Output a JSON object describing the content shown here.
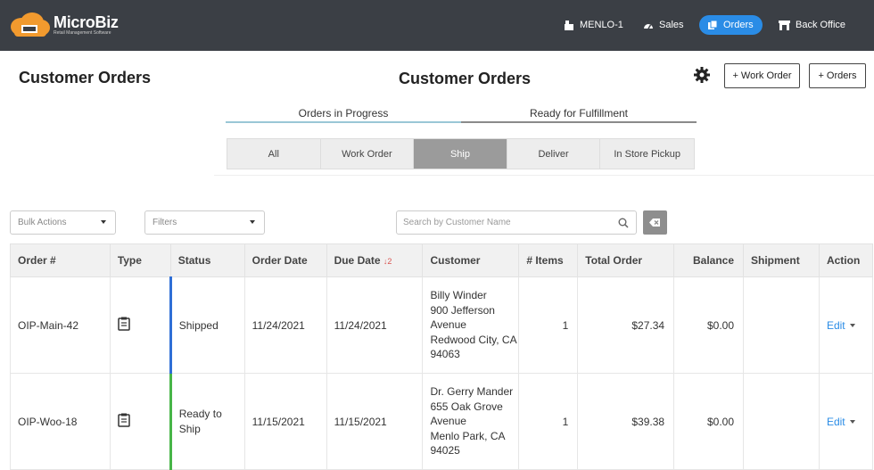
{
  "app": {
    "name": "MicroBiz",
    "tagline": "Retail Management Software"
  },
  "nav": [
    {
      "label": "MENLO-1",
      "icon": "register-icon"
    },
    {
      "label": "Sales",
      "icon": "speedometer-icon"
    },
    {
      "label": "Orders",
      "icon": "orders-icon",
      "active": true
    },
    {
      "label": "Back Office",
      "icon": "store-icon"
    }
  ],
  "page": {
    "title_left": "Customer Orders",
    "title_center": "Customer Orders"
  },
  "header_buttons": {
    "work_order": "+ Work Order",
    "orders": "+ Orders"
  },
  "top_tabs": [
    "Orders in Progress",
    "Ready for Fulfillment"
  ],
  "segments": [
    "All",
    "Work Order",
    "Ship",
    "Deliver",
    "In Store Pickup"
  ],
  "active_segment": "Ship",
  "toolbar": {
    "bulk_actions": "Bulk Actions",
    "filters": "Filters",
    "search_placeholder": "Search by Customer Name"
  },
  "table": {
    "headers": {
      "order": "Order #",
      "type": "Type",
      "status": "Status",
      "order_date": "Order Date",
      "due_date": "Due Date",
      "due_sort": "↓2",
      "customer": "Customer",
      "items": "# Items",
      "total": "Total Order",
      "balance": "Balance",
      "shipment": "Shipment",
      "action": "Action"
    },
    "rows": [
      {
        "order": "OIP-Main-42",
        "status": "Shipped",
        "order_date": "11/24/2021",
        "due_date": "11/24/2021",
        "customer": [
          "Billy Winder",
          "900 Jefferson",
          "Avenue",
          "Redwood City, CA",
          "94063"
        ],
        "items": "1",
        "total": "$27.34",
        "balance": "$0.00",
        "shipment": "",
        "action": "Edit",
        "status_color": "#2f6fd6"
      },
      {
        "order": "OIP-Woo-18",
        "status_lines": [
          "Ready to",
          "Ship"
        ],
        "order_date": "11/15/2021",
        "due_date": "11/15/2021",
        "customer": [
          "Dr. Gerry Mander",
          "655 Oak Grove",
          "Avenue",
          "Menlo Park, CA",
          "94025"
        ],
        "items": "1",
        "total": "$39.38",
        "balance": "$0.00",
        "shipment": "",
        "action": "Edit",
        "status_color": "#47b548"
      }
    ]
  },
  "colors": {
    "topbar": "#3b3f45",
    "accent": "#2a8ce6",
    "logo": "#f29a2e"
  }
}
